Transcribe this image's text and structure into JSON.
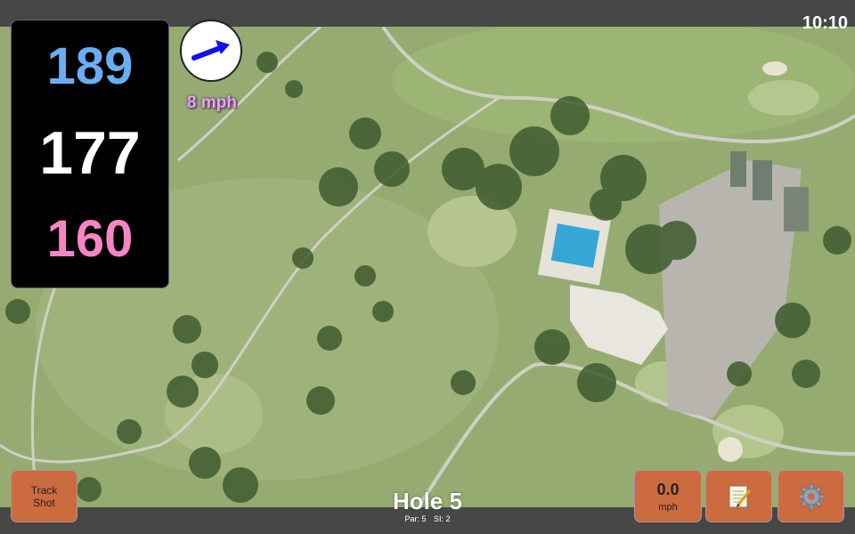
{
  "status": {
    "time": "10:10"
  },
  "yardages": {
    "back": "189",
    "center": "177",
    "front": "160"
  },
  "wind": {
    "speed": "8 mph",
    "arrow_icon": "wind-direction-arrow-icon"
  },
  "hole": {
    "title": "Hole 5",
    "par": "Par: 5",
    "si": "SI: 2"
  },
  "buttons": {
    "track_shot_line1": "Track",
    "track_shot_line2": "Shot",
    "speed_value": "0.0",
    "speed_unit": "mph",
    "notes_icon": "notepad-icon",
    "settings_icon": "gear-icon"
  },
  "colors": {
    "back_yardage": "#6aaef2",
    "center_yardage": "#ffffff",
    "front_yardage": "#f585c4",
    "button": "#cc6b3f",
    "wind_text": "#e5a8ef"
  }
}
